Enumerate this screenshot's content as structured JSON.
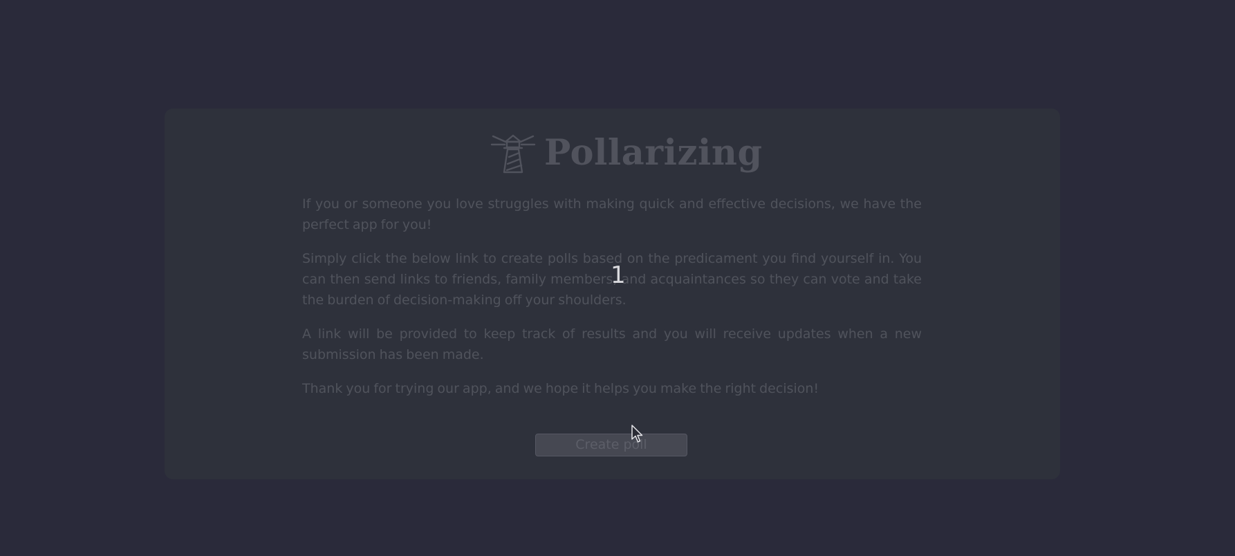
{
  "app": {
    "brand_name": "Pollarizing",
    "logo_icon": "lighthouse-icon"
  },
  "intro": {
    "paragraphs": [
      "If you or someone you love struggles with making quick and effective decisions, we have the perfect app for you!",
      "Simply click the below link to create polls based on the predicament you find yourself in. You can then send links to friends, family members, and acquaintances so they can vote and take the burden of decision-making off your shoulders.",
      "A link will be provided to keep track of results and you will receive updates when a new submission has been made.",
      "Thank you for trying our app, and we hope it helps you make the right decision!"
    ]
  },
  "actions": {
    "create_poll_label": "Create poll"
  },
  "overlay": {
    "step_number": "1",
    "cursor_icon": "mouse-pointer-icon"
  },
  "colors": {
    "page_background": "#2a2a3a",
    "card_background": "#2e313b",
    "muted_text": "#50535c",
    "button_background": "#464852"
  }
}
